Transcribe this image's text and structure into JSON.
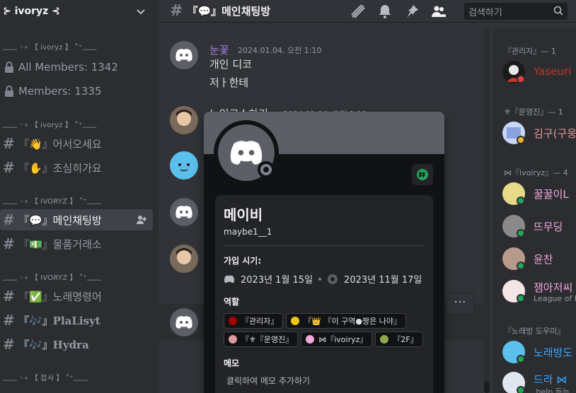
{
  "server": {
    "name": "⊱ ivoryz ⊰"
  },
  "sidebar": {
    "categories": [
      "﹏﹏ ◦∘ 【 ivoryz 】 ˚⁺﹏﹏",
      "﹏﹏ ◦∘ 【 ivoryz 】 ˚⁺﹏﹏",
      "﹏﹏ ◦∘ 【 IVORYZ 】 ˚⁺﹏﹏",
      "﹏﹏ ◦∘ 【 IVORYZ 】 ˚⁺﹏﹏",
      "﹏﹏ ◦∘ 【 잡사 】 ˚⁺﹏﹏"
    ],
    "stats": [
      {
        "label": "All Members: 1342"
      },
      {
        "label": "Members: 1335"
      }
    ],
    "channels": [
      {
        "label": "『👋』어서오세요"
      },
      {
        "label": "『✋』조심히가요"
      },
      {
        "label": "『💬』메인채팅방"
      },
      {
        "label": "『💵』물품거래소"
      },
      {
        "label": "『✅』노래명령어"
      },
      {
        "label": "『🎶』PlaLisyt"
      },
      {
        "label": "『🎶』Hydra"
      }
    ]
  },
  "channel": {
    "title": "『💬』메인채팅방"
  },
  "search": {
    "placeholder": "검색하기"
  },
  "messages": [
    {
      "author": "눈꽃",
      "time": "2024.01.04. 오전 1:10",
      "lines": [
        "개인 디코",
        "저ㅏ한테"
      ]
    },
    {
      "author": "노인코스하기",
      "time": "2024.01.04. 오전 1:11"
    }
  ],
  "more_label": "···",
  "profile": {
    "display_name": "메이비",
    "username": "maybe1__1",
    "joined_label": "가입 시기:",
    "discord_joined": "2023년 1월 15일",
    "server_joined": "2023년 11월 17일",
    "roles_label": "역할",
    "roles": [
      {
        "name": "『관리자』",
        "color": "#a80000"
      },
      {
        "name": "『👑 『이 구역●짱은 나야』",
        "color": "#f1c40f"
      },
      {
        "name": "『⚜『운영진』",
        "color": "#d99a9a"
      },
      {
        "name": "⋈『ivoiryz』",
        "color": "#f0a8d8"
      },
      {
        "name": "『2F』",
        "color": "#8fa84a"
      }
    ],
    "memo_label": "메모",
    "memo_placeholder": "클릭하여 메모 추가하기"
  },
  "members": {
    "groups": [
      {
        "header": "『관리자』— 1"
      },
      {
        "header": "⚜『운영진』— 1"
      },
      {
        "header": "⋈『ivoiryz』— 4"
      },
      {
        "header": "『노래방 도우미』"
      }
    ],
    "list": [
      {
        "name": "Yaseuri",
        "color": "#c0392b",
        "status": "dnd"
      },
      {
        "name": "김구(구웅",
        "color": "#e89a9a",
        "status": "idle"
      },
      {
        "name": "꿀꿀이L",
        "color": "#f0a8d8",
        "status": "online"
      },
      {
        "name": "뜨무딩",
        "color": "#f0a8d8",
        "status": "online"
      },
      {
        "name": "윤찬",
        "color": "#f0a8d8",
        "status": "online"
      },
      {
        "name": "잼아저씨",
        "color": "#f0a8d8",
        "status": "online",
        "sub": "League of L"
      },
      {
        "name": "노래방도",
        "color": "#3ba7ff",
        "status": "online"
      },
      {
        "name": "드라 ⋈",
        "color": "#3ba7ff",
        "status": "online",
        "sub": ".help 듣는"
      }
    ]
  },
  "colors": {
    "online": "#23a55a",
    "idle": "#f0b232",
    "dnd": "#f23f43",
    "blurple": "#5865f2",
    "mention": "#a782e8"
  }
}
